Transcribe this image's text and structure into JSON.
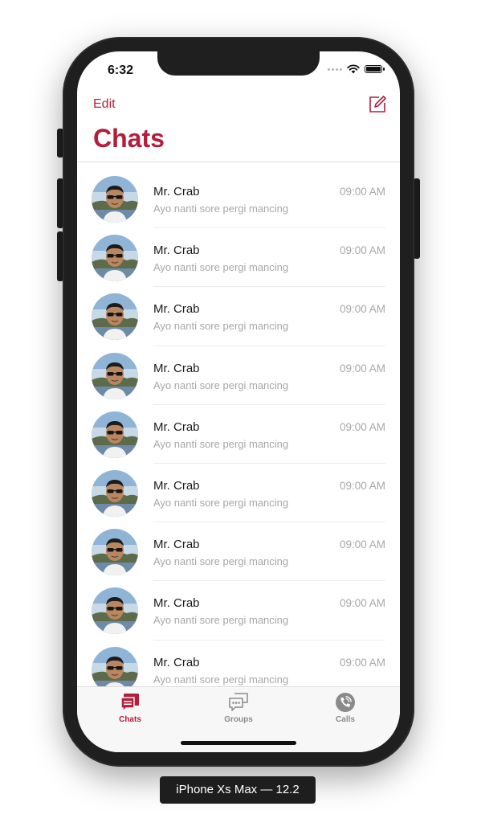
{
  "status_bar": {
    "time": "6:32"
  },
  "nav": {
    "edit_label": "Edit",
    "title": "Chats"
  },
  "chats": [
    {
      "name": "Mr. Crab",
      "message": "Ayo nanti sore pergi mancing",
      "time": "09:00 AM"
    },
    {
      "name": "Mr. Crab",
      "message": "Ayo nanti sore pergi mancing",
      "time": "09:00 AM"
    },
    {
      "name": "Mr. Crab",
      "message": "Ayo nanti sore pergi mancing",
      "time": "09:00 AM"
    },
    {
      "name": "Mr. Crab",
      "message": "Ayo nanti sore pergi mancing",
      "time": "09:00 AM"
    },
    {
      "name": "Mr. Crab",
      "message": "Ayo nanti sore pergi mancing",
      "time": "09:00 AM"
    },
    {
      "name": "Mr. Crab",
      "message": "Ayo nanti sore pergi mancing",
      "time": "09:00 AM"
    },
    {
      "name": "Mr. Crab",
      "message": "Ayo nanti sore pergi mancing",
      "time": "09:00 AM"
    },
    {
      "name": "Mr. Crab",
      "message": "Ayo nanti sore pergi mancing",
      "time": "09:00 AM"
    },
    {
      "name": "Mr. Crab",
      "message": "Ayo nanti sore pergi mancing",
      "time": "09:00 AM"
    }
  ],
  "tabs": [
    {
      "label": "Chats",
      "icon": "chat-bubbles-icon",
      "active": true
    },
    {
      "label": "Groups",
      "icon": "group-chat-icon",
      "active": false
    },
    {
      "label": "Calls",
      "icon": "phone-icon",
      "active": false
    }
  ],
  "device_label": "iPhone Xs Max — 12.2",
  "colors": {
    "accent": "#b31e3c",
    "muted": "#a7a7a7",
    "tab_inactive": "#8a8a8a"
  }
}
